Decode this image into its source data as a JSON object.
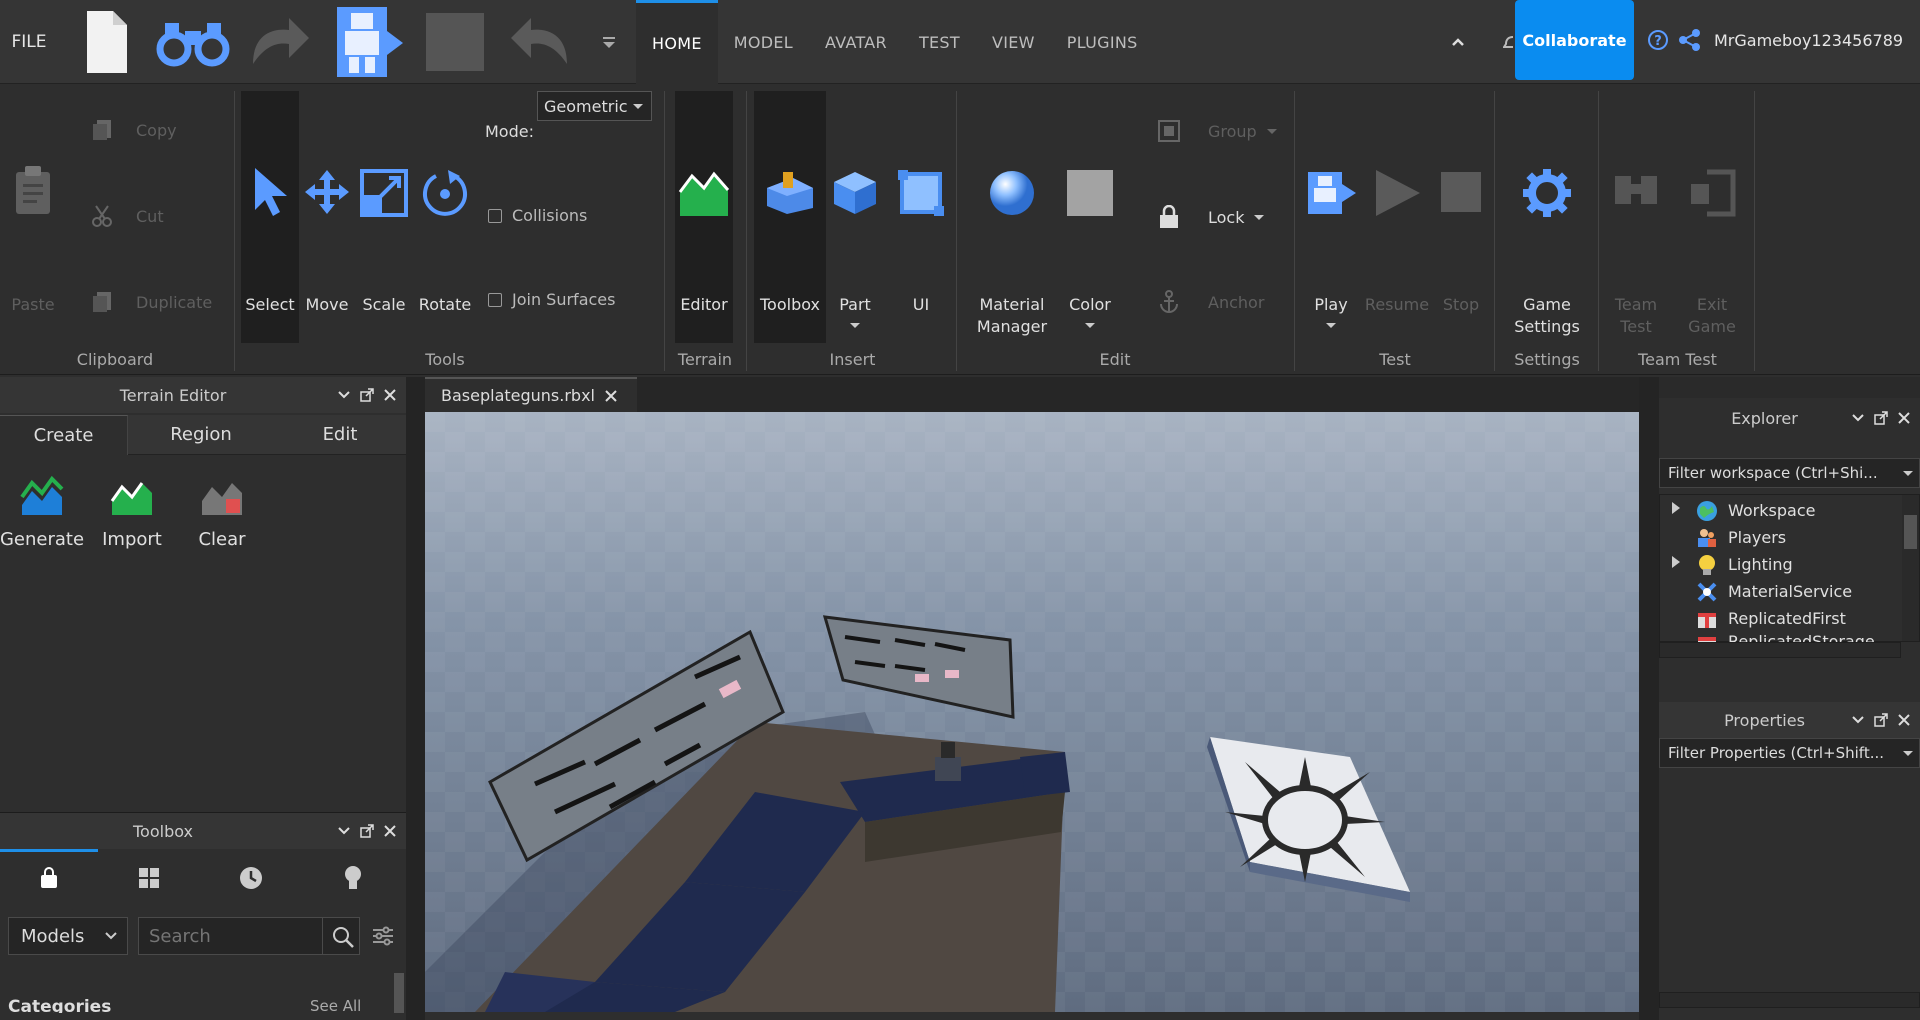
{
  "topbar": {
    "file_label": "FILE",
    "tabs": [
      "HOME",
      "MODEL",
      "AVATAR",
      "TEST",
      "VIEW",
      "PLUGINS"
    ],
    "collaborate_label": "Collaborate",
    "username": "MrGameboy123456789"
  },
  "ribbon": {
    "clipboard": {
      "copy": "Copy",
      "cut": "Cut",
      "paste": "Paste",
      "duplicate": "Duplicate",
      "label": "Clipboard"
    },
    "tools": {
      "select": "Select",
      "move": "Move",
      "scale": "Scale",
      "rotate": "Rotate",
      "mode_label": "Mode:",
      "mode_value": "Geometric",
      "collisions": "Collisions",
      "join_surfaces": "Join Surfaces",
      "label": "Tools"
    },
    "terrain": {
      "editor": "Editor",
      "label": "Terrain"
    },
    "insert": {
      "toolbox": "Toolbox",
      "part": "Part",
      "ui": "UI",
      "label": "Insert"
    },
    "edit": {
      "material_manager_1": "Material",
      "material_manager_2": "Manager",
      "color": "Color",
      "group": "Group",
      "lock": "Lock",
      "anchor": "Anchor",
      "label": "Edit"
    },
    "test": {
      "play": "Play",
      "resume": "Resume",
      "stop": "Stop",
      "label": "Test"
    },
    "settings": {
      "game_settings_1": "Game",
      "game_settings_2": "Settings",
      "label": "Settings"
    },
    "team_test": {
      "team_test_1": "Team",
      "team_test_2": "Test",
      "exit_game_1": "Exit",
      "exit_game_2": "Game",
      "label": "Team Test"
    }
  },
  "terrain_editor": {
    "title": "Terrain Editor",
    "tabs": [
      "Create",
      "Region",
      "Edit"
    ],
    "tools": [
      "Generate",
      "Import",
      "Clear"
    ]
  },
  "toolbox": {
    "title": "Toolbox",
    "category": "Models",
    "search_placeholder": "Search",
    "partial_heading": "Categories",
    "see_all": "See All"
  },
  "document": {
    "tab_name": "Baseplateguns.rbxl"
  },
  "explorer": {
    "title": "Explorer",
    "filter_placeholder": "Filter workspace (Ctrl+Shi...",
    "items": [
      "Workspace",
      "Players",
      "Lighting",
      "MaterialService",
      "ReplicatedFirst",
      "ReplicatedStorage"
    ]
  },
  "properties": {
    "title": "Properties",
    "filter_placeholder": "Filter Properties (Ctrl+Shift..."
  },
  "colors": {
    "accent": "#0a8cf0",
    "icon_blue": "#5b9bff",
    "bg": "#2e2e2e"
  }
}
